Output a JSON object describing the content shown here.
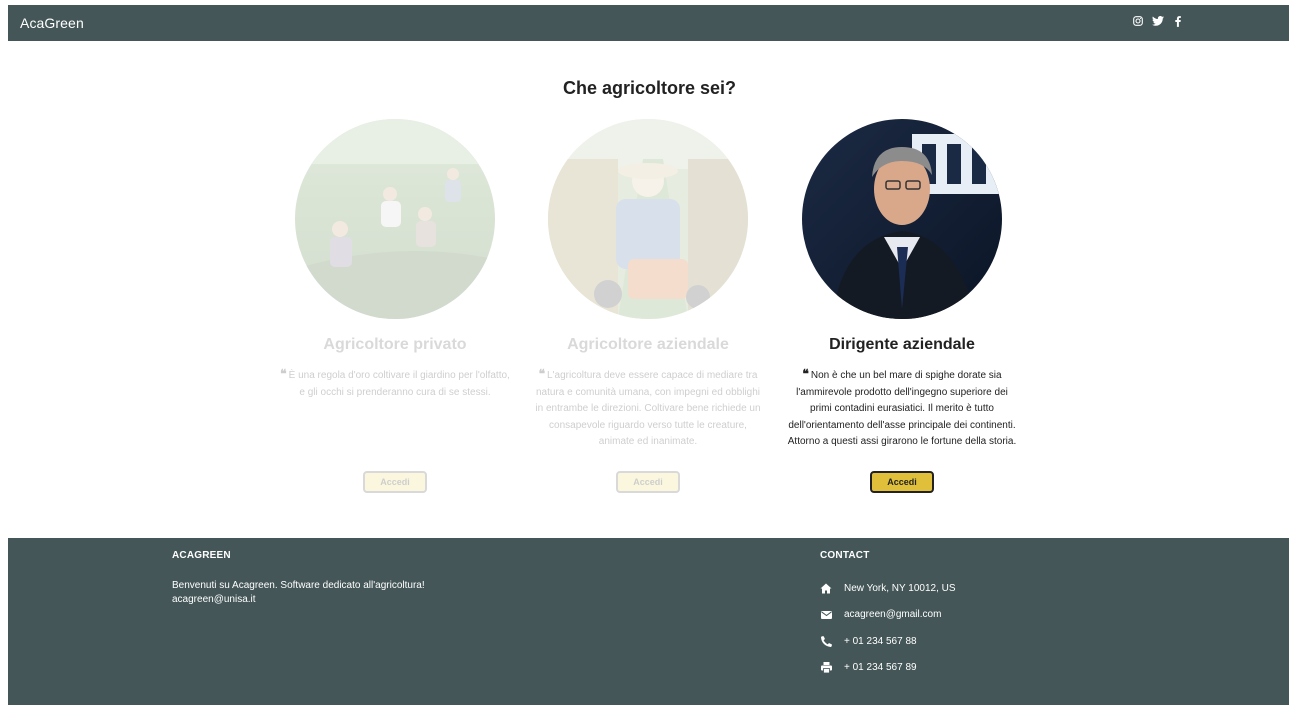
{
  "navbar": {
    "brand": "AcaGreen",
    "social_icons": [
      "instagram-icon",
      "twitter-icon",
      "facebook-icon"
    ]
  },
  "heading": "Che agricoltore sei?",
  "cards": [
    {
      "title": "Agricoltore privato",
      "quote": "È una regola d'oro coltivare il giardino per l'olfatto, e gli occhi si prenderanno cura di se stessi.",
      "button": "Accedi",
      "state": "faded"
    },
    {
      "title": "Agricoltore aziendale",
      "quote": "L'agricoltura deve essere capace di mediare tra natura e comunità umana, con impegni ed obblighi in entrambe le direzioni. Coltivare bene richiede un consapevole riguardo verso tutte le creature, animate ed inanimate.",
      "button": "Accedi",
      "state": "faded"
    },
    {
      "title": "Dirigente aziendale",
      "quote": "Non è che un bel mare di spighe dorate sia l'ammirevole prodotto dell'ingegno superiore dei primi contadini eurasiatici. Il merito è tutto dell'orientamento dell'asse principale dei continenti. Attorno a questi assi girarono le fortune della storia.",
      "button": "Accedi",
      "state": "active"
    }
  ],
  "footer": {
    "left": {
      "title": "ACAGREEN",
      "description": "Benvenuti su Acagreen. Software dedicato all'agricoltura!",
      "email": "acagreen@unisa.it"
    },
    "right": {
      "title": "CONTACT",
      "items": [
        {
          "icon": "home-icon",
          "text": "New York, NY 10012, US"
        },
        {
          "icon": "envelope-icon",
          "text": "acagreen@gmail.com"
        },
        {
          "icon": "phone-icon",
          "text": "+ 01 234 567 88"
        },
        {
          "icon": "print-icon",
          "text": "+ 01 234 567 89"
        }
      ]
    }
  },
  "colors": {
    "bar": "#445658",
    "button": "#e0c03a",
    "text": "#222222"
  }
}
